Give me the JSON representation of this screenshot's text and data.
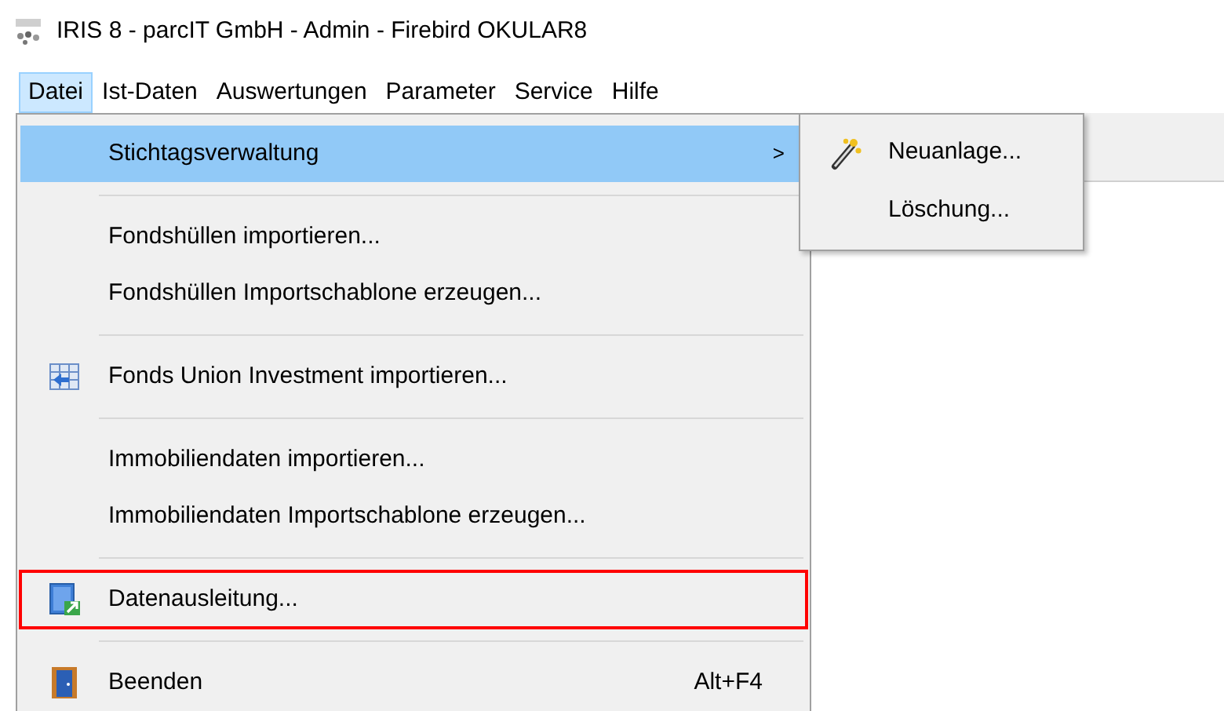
{
  "window": {
    "title": "IRIS 8 - parcIT GmbH - Admin - Firebird OKULAR8"
  },
  "menu_bar": [
    {
      "label": "Datei",
      "selected": true
    },
    {
      "label": "Ist-Daten",
      "selected": false
    },
    {
      "label": "Auswertungen",
      "selected": false
    },
    {
      "label": "Parameter",
      "selected": false
    },
    {
      "label": "Service",
      "selected": false
    },
    {
      "label": "Hilfe",
      "selected": false
    }
  ],
  "dropdown": {
    "items": [
      {
        "kind": "item",
        "label": "Stichtagsverwaltung",
        "selected": true,
        "arrow": ">"
      },
      {
        "kind": "separator"
      },
      {
        "kind": "item",
        "label": "Fondshüllen importieren...",
        "selected": false
      },
      {
        "kind": "item",
        "label": "Fondshüllen Importschablone erzeugen...",
        "selected": false
      },
      {
        "kind": "separator"
      },
      {
        "kind": "item",
        "label": "Fonds Union Investment importieren...",
        "selected": false
      },
      {
        "kind": "separator"
      },
      {
        "kind": "item",
        "label": "Immobiliendaten importieren...",
        "selected": false
      },
      {
        "kind": "item",
        "label": "Immobiliendaten Importschablone erzeugen...",
        "selected": false
      },
      {
        "kind": "separator"
      },
      {
        "kind": "item",
        "label": "Datenausleitung...",
        "selected": false,
        "outlined": true
      },
      {
        "kind": "separator"
      },
      {
        "kind": "item",
        "label": "Beenden",
        "selected": false,
        "shortcut": "Alt+F4"
      }
    ]
  },
  "submenu": {
    "items": [
      {
        "label": "Neuanlage...",
        "selected": false
      },
      {
        "label": "Löschung...",
        "selected": false
      }
    ]
  }
}
